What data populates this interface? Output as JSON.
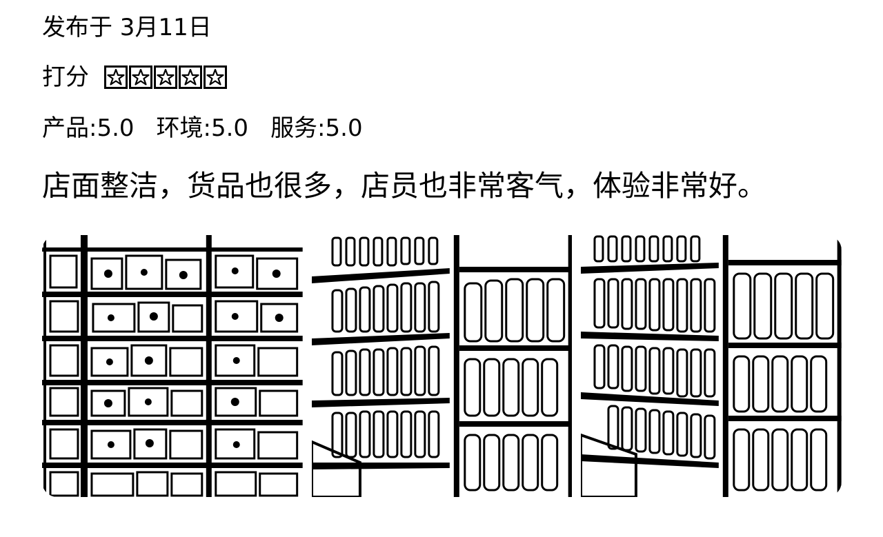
{
  "review": {
    "date_text": "发布于 3月11日",
    "rating_label": "打分",
    "stars": [
      {
        "icon": "star-outline-icon"
      },
      {
        "icon": "star-outline-icon"
      },
      {
        "icon": "star-outline-icon"
      },
      {
        "icon": "star-outline-icon"
      },
      {
        "icon": "star-outline-icon"
      }
    ],
    "rating_value": 5,
    "scores": {
      "product": "产品:5.0",
      "environment": "环境:5.0",
      "service": "服务:5.0"
    },
    "content": "店面整洁，货品也很多，店员也非常客气，体验非常好。"
  },
  "gallery": {
    "photos": [
      {
        "subject": "snack-shelves"
      },
      {
        "subject": "bottle-shelves"
      },
      {
        "subject": "bottle-shelves"
      }
    ]
  },
  "colors": {
    "text": "#000000",
    "background": "#ffffff"
  }
}
